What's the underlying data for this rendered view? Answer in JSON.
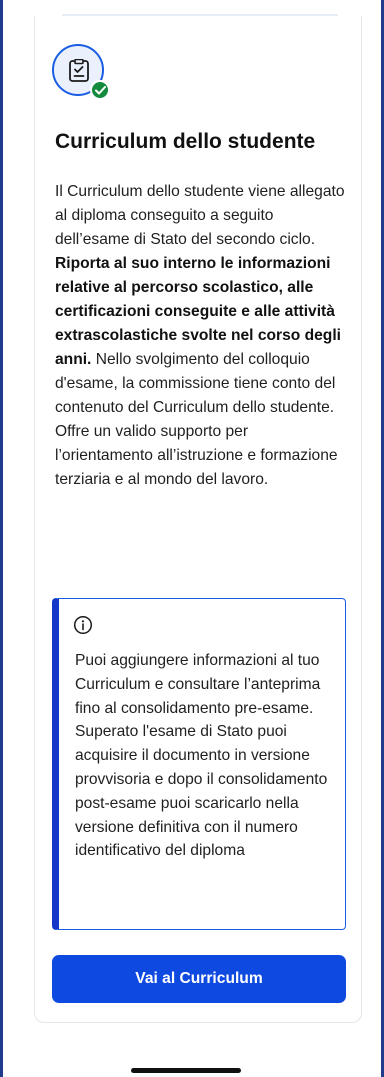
{
  "section": {
    "title": "Curriculum dello studente",
    "description": {
      "intro": "Il Curriculum dello studente viene allegato al diploma conseguito a seguito dell’esame di Stato del secondo ciclo. ",
      "bold": "Riporta al suo interno le informazioni relative al percorso scolastico, alle certificazioni conseguite e alle attività extrascolastiche svolte nel corso degli anni.",
      "rest": " Nello svolgimento del colloquio d'esame, la commissione tiene conto del contenuto del Curriculum dello studente. Offre un valido supporto per l’orientamento all’istruzione e formazione terziaria e al mondo del lavoro."
    },
    "callout": {
      "text": "Puoi aggiungere informazioni al tuo Curriculum e consultare l’anteprima fino al consolidamento pre-esame. Superato l'esame di Stato puoi acquisire il documento in versione provvisoria e dopo il consolidamento post-esame puoi scaricarlo nella versione definitiva con il numero identificativo del diploma"
    },
    "cta_label": "Vai al Curriculum",
    "icon": "document-check-icon"
  },
  "colors": {
    "primary": "#0f4ae0",
    "callout_border": "#1237c9",
    "success": "#138a3d",
    "icon_bg": "#eaf1fd"
  }
}
